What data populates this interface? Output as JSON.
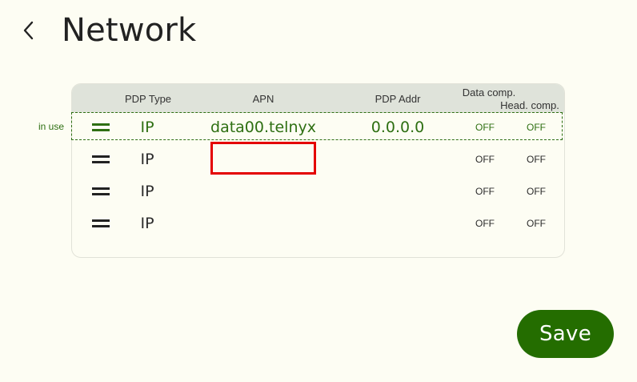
{
  "header": {
    "title": "Network",
    "back_icon": "chevron-left-icon"
  },
  "table": {
    "columns": {
      "pdp_type": "PDP Type",
      "apn": "APN",
      "pdp_addr": "PDP Addr",
      "data_comp": "Data comp.",
      "head_comp": "Head. comp."
    },
    "in_use_label": "in use",
    "rows": [
      {
        "pdp_type": "IP",
        "apn": "data00.telnyx",
        "pdp_addr": "0.0.0.0",
        "data_comp": "OFF",
        "head_comp": "OFF",
        "in_use": true
      },
      {
        "pdp_type": "IP",
        "apn": "",
        "pdp_addr": "",
        "data_comp": "OFF",
        "head_comp": "OFF",
        "in_use": false
      },
      {
        "pdp_type": "IP",
        "apn": "",
        "pdp_addr": "",
        "data_comp": "OFF",
        "head_comp": "OFF",
        "in_use": false
      },
      {
        "pdp_type": "IP",
        "apn": "",
        "pdp_addr": "",
        "data_comp": "OFF",
        "head_comp": "OFF",
        "in_use": false
      }
    ]
  },
  "actions": {
    "save_label": "Save"
  },
  "colors": {
    "background": "#fdfdf3",
    "accent_green": "#2e6f12",
    "save_button": "#246d00",
    "header_row": "#dfe3da",
    "highlight_red": "#e40000"
  }
}
